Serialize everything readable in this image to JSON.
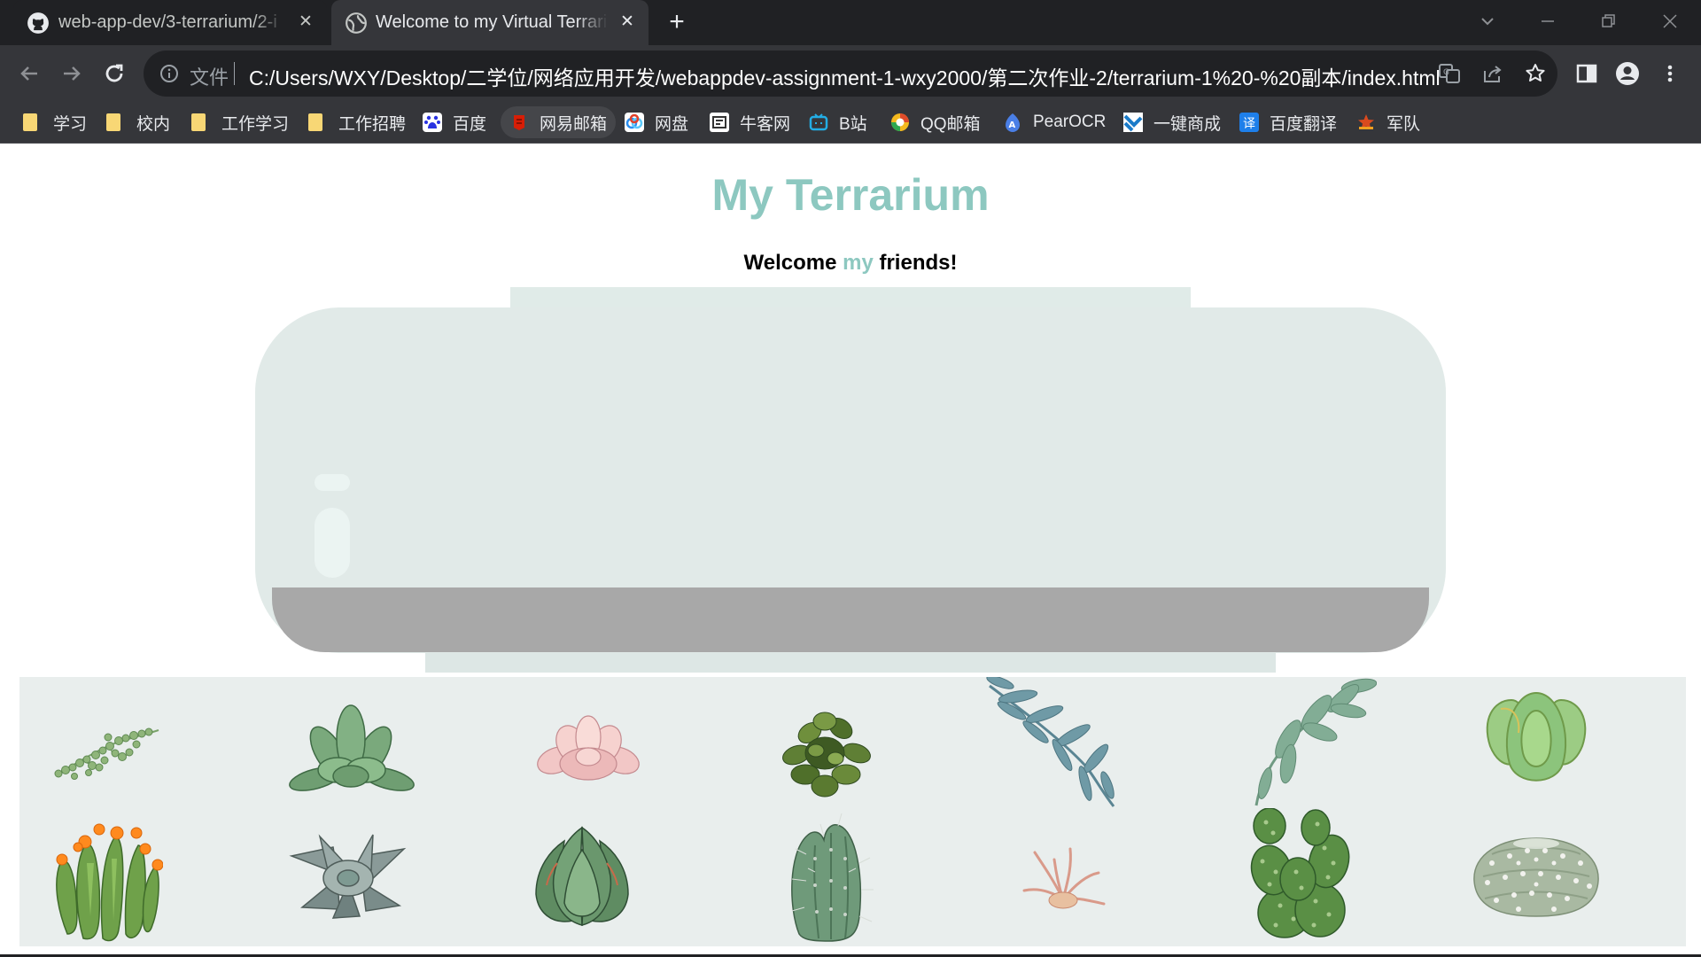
{
  "browser": {
    "tabs": [
      {
        "title": "web-app-dev/3-terrarium/2-i",
        "icon": "github-icon",
        "active": false
      },
      {
        "title": "Welcome to my Virtual Terrari",
        "icon": "globe-icon",
        "active": true
      }
    ],
    "address_bar": {
      "scheme_label": "文件",
      "url": "C:/Users/WXY/Desktop/二学位/网络应用开发/webappdev-assignment-1-wxy2000/第二次作业-2/terrarium-1%20-%20副本/index.html"
    },
    "bookmarks": [
      {
        "label": "学习",
        "icon": "folder-icon"
      },
      {
        "label": "校内",
        "icon": "folder-icon"
      },
      {
        "label": "工作学习",
        "icon": "folder-icon"
      },
      {
        "label": "工作招聘",
        "icon": "folder-icon"
      },
      {
        "label": "百度",
        "icon": "baidu-paw-icon"
      },
      {
        "label": "网易邮箱",
        "icon": "netease-mail-icon"
      },
      {
        "label": "网盘",
        "icon": "cloud-drive-icon"
      },
      {
        "label": "牛客网",
        "icon": "nowcoder-icon"
      },
      {
        "label": "B站",
        "icon": "bilibili-tv-icon"
      },
      {
        "label": "QQ邮箱",
        "icon": "qq-mail-icon"
      },
      {
        "label": "PearOCR",
        "icon": "pearocr-icon"
      },
      {
        "label": "一键商成",
        "icon": "shop-icon"
      },
      {
        "label": "百度翻译",
        "icon": "translate-icon"
      },
      {
        "label": "军队",
        "icon": "army-icon"
      }
    ],
    "colors": {
      "tab_strip": "#202124",
      "toolbar": "#35363a",
      "omnibox": "#202124"
    }
  },
  "page": {
    "title": "My Terrarium",
    "welcome": {
      "prefix": "Welcome ",
      "highlight": "my",
      "suffix": " friends!"
    },
    "colors": {
      "accent": "#8dc8c0",
      "jar": "#e1eae8",
      "dirt": "#a8a8a8",
      "plant_panel": "#e9eeed"
    },
    "plants": [
      {
        "name": "string-of-pearls"
      },
      {
        "name": "green-rosette-succulent"
      },
      {
        "name": "pink-succulent"
      },
      {
        "name": "dark-leafy-shrub"
      },
      {
        "name": "blue-eucalyptus-sprig"
      },
      {
        "name": "green-eucalyptus-sprig"
      },
      {
        "name": "jade-succulent"
      },
      {
        "name": "flowering-cactus"
      },
      {
        "name": "grey-echeveria"
      },
      {
        "name": "aloe-succulent"
      },
      {
        "name": "columnar-cactus"
      },
      {
        "name": "air-plant"
      },
      {
        "name": "bunny-ear-cactus"
      },
      {
        "name": "white-fuzzy-cactus"
      }
    ]
  }
}
